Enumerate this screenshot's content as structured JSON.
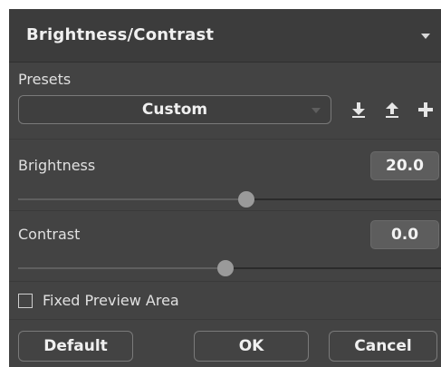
{
  "header": {
    "title": "Brightness/Contrast"
  },
  "presets": {
    "label": "Presets",
    "selected": "Custom",
    "icons": [
      "download-icon",
      "upload-icon",
      "plus-icon"
    ]
  },
  "brightness": {
    "label": "Brightness",
    "value": "20.0",
    "slider_position": 0.56
  },
  "contrast": {
    "label": "Contrast",
    "value": "0.0",
    "slider_position": 0.5
  },
  "fixed_preview": {
    "label": "Fixed Preview Area",
    "checked": false
  },
  "buttons": {
    "default_label": "Default",
    "ok_label": "OK",
    "cancel_label": "Cancel"
  },
  "colors": {
    "panel_bg": "#434343",
    "header_bg": "#3c3c3c",
    "text": "#e6e6e6",
    "value_box_bg": "#5d5d5d"
  }
}
